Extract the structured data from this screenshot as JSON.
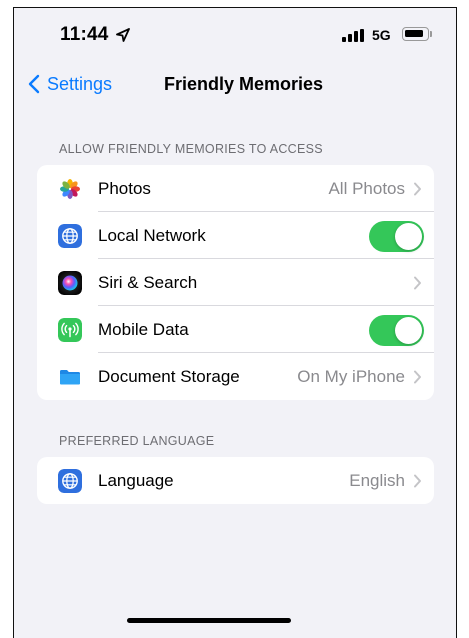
{
  "status_bar": {
    "time": "11:44",
    "network": "5G"
  },
  "nav": {
    "back_label": "Settings",
    "title": "Friendly Memories"
  },
  "access_section": {
    "header": "ALLOW FRIENDLY MEMORIES TO ACCESS",
    "rows": [
      {
        "label": "Photos",
        "value": "All Photos",
        "icon": "photos-icon"
      },
      {
        "label": "Local Network",
        "toggle_on": true,
        "icon": "local-network-icon"
      },
      {
        "label": "Siri & Search",
        "value": "",
        "icon": "siri-icon"
      },
      {
        "label": "Mobile Data",
        "toggle_on": true,
        "icon": "mobile-data-icon"
      },
      {
        "label": "Document Storage",
        "value": "On My iPhone",
        "icon": "folder-icon"
      }
    ]
  },
  "language_section": {
    "header": "PREFERRED LANGUAGE",
    "rows": [
      {
        "label": "Language",
        "value": "English",
        "icon": "globe-icon"
      }
    ]
  },
  "colors": {
    "accent": "#0a7bff",
    "toggle_on": "#34c759",
    "background": "#f2f2f7"
  }
}
